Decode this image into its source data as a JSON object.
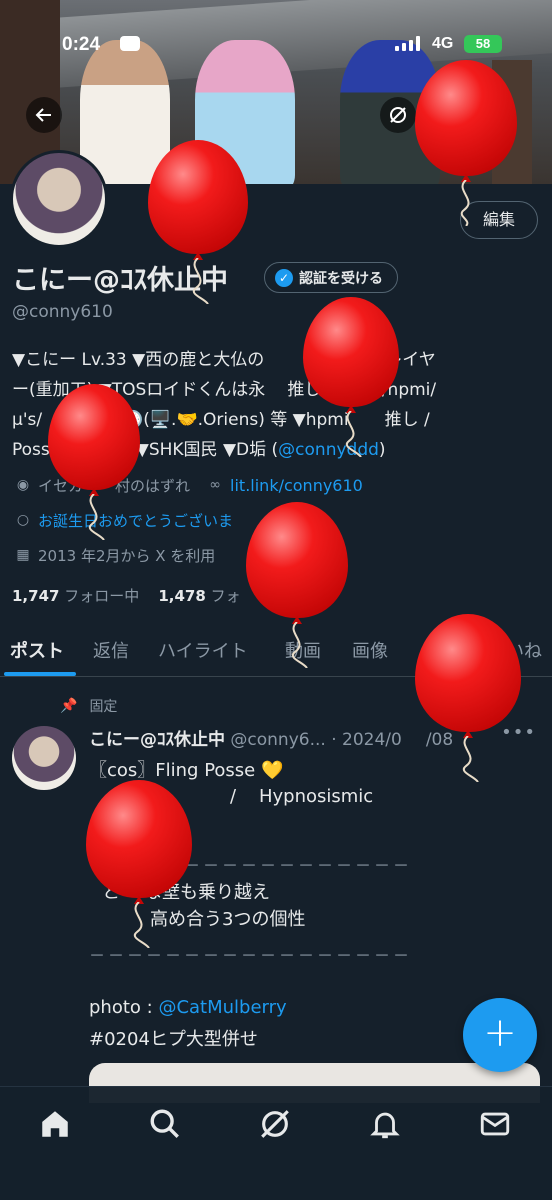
{
  "status_bar": {
    "time": "0:24",
    "network": "4G",
    "battery": "58"
  },
  "profile": {
    "edit_label": "編集",
    "display_name": "こにー@ｺｽ休止中",
    "verify_label": "認証を受ける",
    "handle": "@conny610",
    "bio_line1": "▼こにー Lv.33 ▼西の鹿と大仏の",
    "bio_line1b": "コスプレイヤ",
    "bio_line2": "ー(重加工) ▼TOSロイドくんは永",
    "bio_line2b": "推し ▼Tales/hpmi/",
    "bio_line3": "μ's/",
    "bio_line3b": "🕒(🖥️.🤝.Oriens) 等 ▼hpmi",
    "bio_line3c": "推し /",
    "bio_line4": "Poss",
    "bio_line4b": "▼SHK国民 ▼D垢 (",
    "bio_mention": "@connyddd",
    "bio_line4c": ")",
    "location": "イセカ",
    "location_tail": "村のはずれ",
    "website": "lit.link/conny610",
    "birthday": "お誕生日おめでとうございま",
    "joined": "2013 年2月から X を利用",
    "following_count": "1,747",
    "following_label": "フォロー中",
    "followers_count": "1,478",
    "followers_label": "フォ"
  },
  "tabs": [
    "ポスト",
    "返信",
    "ハイライト",
    "動画",
    "画像",
    "いいね"
  ],
  "tweet": {
    "pinned_label": "固定",
    "author": "こにー@ｺｽ休止中",
    "handle": "@conny6...",
    "date": "· 2024/0",
    "date_tail": "/08",
    "line1": "〖cos〗Fling Posse 💛",
    "line2": "/    Hypnosismic",
    "dashes": "－－－－－－－－－－－－－－－－－",
    "line3": "と",
    "line3b": "な壁も乗り越え",
    "line4": "高め合う3つの個性",
    "photo_label": "photo : ",
    "photo_credit": "@CatMulberry",
    "hashtag": "#0204ヒプ大型併せ"
  },
  "icons": [
    "back-arrow-icon",
    "grok-icon",
    "verified-badge-icon",
    "location-icon",
    "link-icon",
    "balloon-icon",
    "calendar-icon",
    "pin-icon",
    "more-icon",
    "plus-icon",
    "home-icon",
    "search-icon",
    "grok-nav-icon",
    "bell-icon",
    "mail-icon"
  ],
  "colors": {
    "background": "#15202b",
    "accent": "#1d9bf0",
    "muted": "#8b98a5",
    "balloon": "#e81010"
  }
}
